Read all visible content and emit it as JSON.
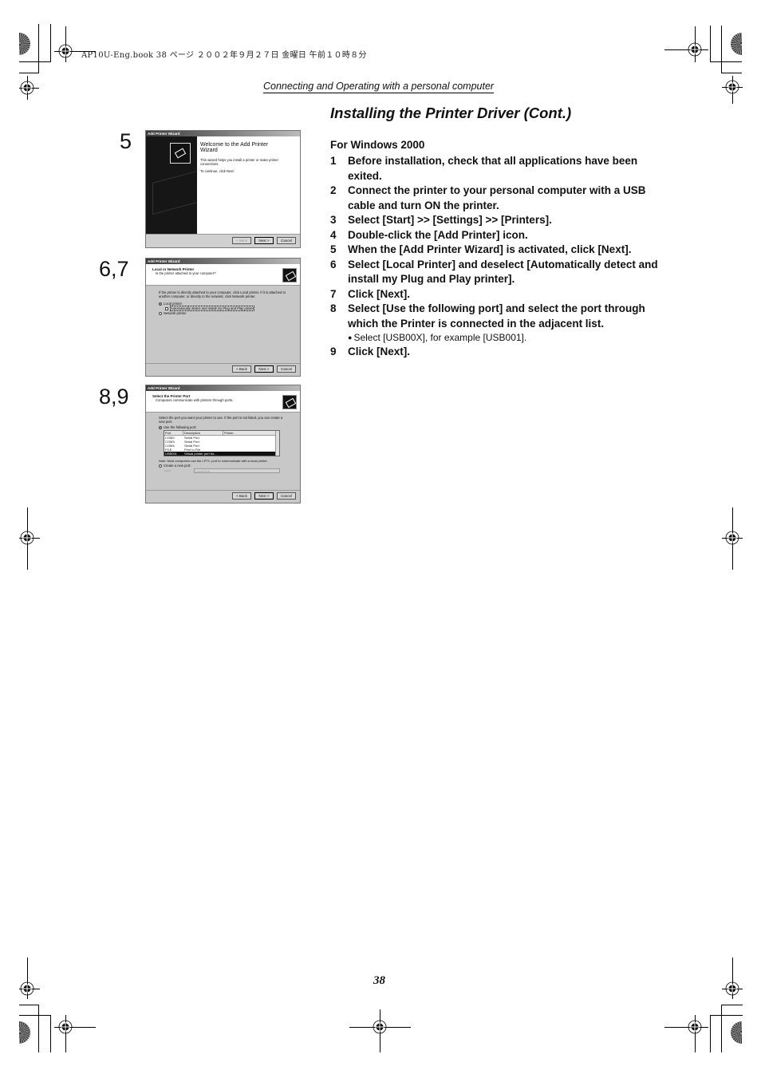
{
  "print_header": {
    "job_line": "AP10U-Eng.book  38 ページ  ２００２年９月２７日  金曜日  午前１０時８分"
  },
  "running_head": "Connecting and Operating with a personal computer",
  "section_title": "Installing the Printer Driver (Cont.)",
  "subheading": "For Windows 2000",
  "steps": [
    {
      "num": "1",
      "text": "Before installation, check that all applications have been exited."
    },
    {
      "num": "2",
      "text": "Connect the printer to your personal computer with a USB cable and turn ON the printer."
    },
    {
      "num": "3",
      "text": "Select [Start] >> [Settings] >> [Printers]."
    },
    {
      "num": "4",
      "text": "Double-click the [Add Printer] icon."
    },
    {
      "num": "5",
      "text": "When the [Add Printer Wizard] is activated, click [Next]."
    },
    {
      "num": "6",
      "text": "Select [Local Printer] and deselect [Automatically detect and install my Plug and Play printer]."
    },
    {
      "num": "7",
      "text": "Click [Next]."
    },
    {
      "num": "8",
      "text": "Select [Use the following port] and select the port through which the Printer is connected in the adjacent list.",
      "note": "Select [USB00X], for example [USB001]."
    },
    {
      "num": "9",
      "text": "Click [Next]."
    }
  ],
  "screenshots": [
    {
      "label": "5",
      "window_title": "Add Printer Wizard",
      "heading": "Welcome to the Add Printer Wizard",
      "body": "This wizard helps you install a printer or make printer connections.",
      "body2": "To continue, click Next.",
      "buttons": [
        "< Back",
        "Next >",
        "Cancel"
      ]
    },
    {
      "label": "6,7",
      "window_title": "Add Printer Wizard",
      "heading": "Local or Network Printer",
      "subheading": "Is the printer attached to your computer?",
      "body": "If the printer is directly attached to your computer, click Local printer. If it is attached to another computer, or directly to the network, click Network printer.",
      "options": {
        "local": "Local printer",
        "auto_detect": "Automatically detect and install my Plug and Play printer",
        "network": "Network printer"
      },
      "buttons": [
        "< Back",
        "Next >",
        "Cancel"
      ]
    },
    {
      "label": "8,9",
      "window_title": "Add Printer Wizard",
      "heading": "Select the Printer Port",
      "subheading": "Computers communicate with printers through ports.",
      "body": "Select the port you want your printer to use. If the port is not listed, you can create a new port.",
      "use_port": "Use the following port:",
      "columns": [
        "Port",
        "Description",
        "Printer"
      ],
      "rows": [
        [
          "COM2:",
          "Serial Port",
          ""
        ],
        [
          "COM3:",
          "Serial Port",
          ""
        ],
        [
          "COM4:",
          "Serial Port",
          ""
        ],
        [
          "FILE:",
          "Print to File",
          ""
        ],
        [
          "USB001",
          "Virtual printer port for...",
          ""
        ]
      ],
      "note": "Note: Most computers use the LPT1: port to communicate with a local printer.",
      "create_port": "Create a new port:",
      "type_label": "Type:",
      "type_value": "Local Port",
      "buttons": [
        "< Back",
        "Next >",
        "Cancel"
      ]
    }
  ],
  "page_number": "38"
}
